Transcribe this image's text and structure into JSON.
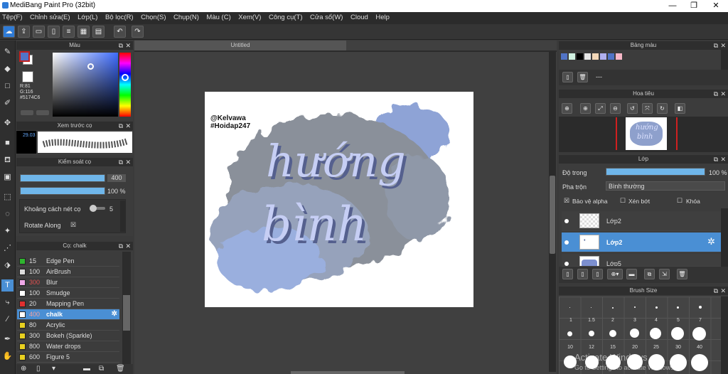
{
  "titlebar": {
    "title": "MediBang Paint Pro (32bit)",
    "minimize": "—",
    "maximize": "❐",
    "close": "✕"
  },
  "menu": [
    "Tệp(F)",
    "Chỉnh sửa(E)",
    "Lớp(L)",
    "Bộ lọc(R)",
    "Chọn(S)",
    "Chụp(N)",
    "Màu (C)",
    "Xem(V)",
    "Công cụ(T)",
    "Cửa sổ(W)",
    "Cloud",
    "Help"
  ],
  "color_panel": {
    "title": "Màu",
    "r": "R:81",
    "g": "G:116",
    "hex": "#5174C6",
    "primary": "#5174C6",
    "secondary": "#FFFFFF"
  },
  "brush_preview": {
    "title": "Xem trước cọ",
    "size": "29.03"
  },
  "brush_control": {
    "title": "Kiểm soát cọ",
    "size_value": "400",
    "opacity_value": "100 %",
    "spacing_label": "Khoảng cách nét cọ",
    "spacing_value": "5",
    "rotate_label": "Rotate Along",
    "rotate_check": "☒"
  },
  "brush_list": {
    "title": "Cọ: chalk",
    "items": [
      {
        "color": "#2fb52f",
        "size": "15",
        "name": "Edge Pen"
      },
      {
        "color": "#dddddd",
        "size": "100",
        "name": "AirBrush"
      },
      {
        "color": "#f0a8e8",
        "size": "300",
        "name": "Blur"
      },
      {
        "color": "#ffffff",
        "size": "100",
        "name": "Smudge"
      },
      {
        "color": "#e03030",
        "size": "20",
        "name": "Mapping Pen"
      },
      {
        "color": "#ffffff",
        "size": "400",
        "name": "chalk"
      },
      {
        "color": "#e8d020",
        "size": "80",
        "name": "Acrylic"
      },
      {
        "color": "#e8d020",
        "size": "300",
        "name": "Bokeh (Sparkle)"
      },
      {
        "color": "#e8d020",
        "size": "800",
        "name": "Water drops"
      },
      {
        "color": "#e8d020",
        "size": "600",
        "name": "Figure 5"
      }
    ]
  },
  "canvas": {
    "tab": "Untitled",
    "credit1": "@Kelvawa",
    "credit2": "#Hoidap247",
    "word1": "hướng",
    "word2": "bình"
  },
  "palette": {
    "title": "Bảng màu",
    "swatches": [
      "#5174C6",
      "#d0f0e0",
      "#000000",
      "#e8e8e8",
      "#f4d8b8",
      "#b0b0f0",
      "#5174c6",
      "#f8b8c8"
    ],
    "none": "---"
  },
  "navigator": {
    "title": "Hoa tiêu",
    "thumb1": "hướng",
    "thumb2": "bình"
  },
  "layer_panel": {
    "title": "Lớp",
    "opacity_label": "Độ trong",
    "opacity_value": "100 %",
    "blend_label": "Pha trộn",
    "blend_value": "Bình thường",
    "alpha_label": "Bảo vệ alpha",
    "clip_label": "Xén bớt",
    "lock_label": "Khóa",
    "layers": [
      {
        "name": "Lớp2"
      },
      {
        "name": "Lớp2"
      },
      {
        "name": "Lớp5"
      }
    ]
  },
  "brush_size": {
    "title": "Brush Size",
    "row1": [
      "1",
      "1.5",
      "2",
      "3",
      "4",
      "5",
      "7"
    ],
    "row2": [
      "10",
      "12",
      "15",
      "20",
      "25",
      "30",
      "40"
    ]
  },
  "watermark": {
    "line1": "Activate Windows",
    "line2": "Go to Settings to activate Windows."
  }
}
